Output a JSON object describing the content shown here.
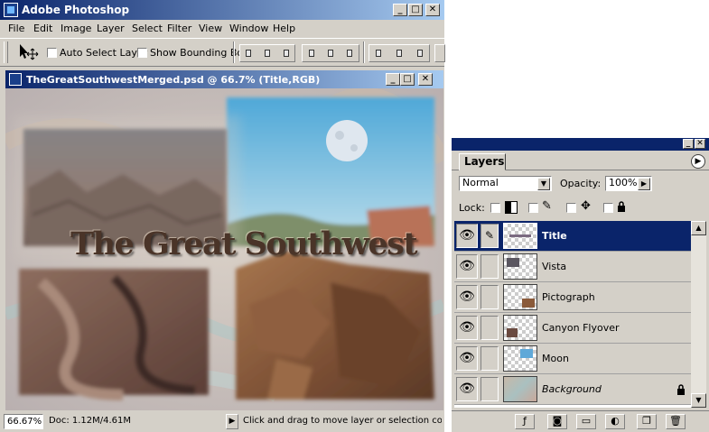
{
  "app": {
    "title": "Adobe Photoshop",
    "window_buttons": [
      "_",
      "□",
      "✕"
    ]
  },
  "menu": [
    "File",
    "Edit",
    "Image",
    "Layer",
    "Select",
    "Filter",
    "View",
    "Window",
    "Help"
  ],
  "options_bar": {
    "auto_select_label": "Auto Select Layer",
    "show_bounding_label": "Show Bounding Box"
  },
  "document": {
    "title": "TheGreatSouthwestMerged.psd @ 66.7% (Title,RGB)",
    "headline": "The Great Southwest"
  },
  "status": {
    "zoom": "66.67%",
    "doc_size": "Doc: 1.12M/4.61M",
    "hint": "Click and drag to move layer or selection constrain"
  },
  "layers_palette": {
    "tab": "Layers",
    "blend_mode": "Normal",
    "opacity_label": "Opacity:",
    "opacity_value": "100%",
    "lock_label": "Lock:",
    "layers": [
      {
        "name": "Title",
        "selected": true,
        "italic": false,
        "locked": false
      },
      {
        "name": "Vista",
        "selected": false,
        "italic": false,
        "locked": false
      },
      {
        "name": "Pictograph",
        "selected": false,
        "italic": false,
        "locked": false
      },
      {
        "name": "Canyon Flyover",
        "selected": false,
        "italic": false,
        "locked": false
      },
      {
        "name": "Moon",
        "selected": false,
        "italic": false,
        "locked": false
      },
      {
        "name": "Background",
        "selected": false,
        "italic": true,
        "locked": true
      }
    ]
  },
  "colors": {
    "titlebar_dark": "#0a246a",
    "titlebar_light": "#a6caf0",
    "chrome": "#d4d0c8",
    "selection": "#0a246a"
  }
}
